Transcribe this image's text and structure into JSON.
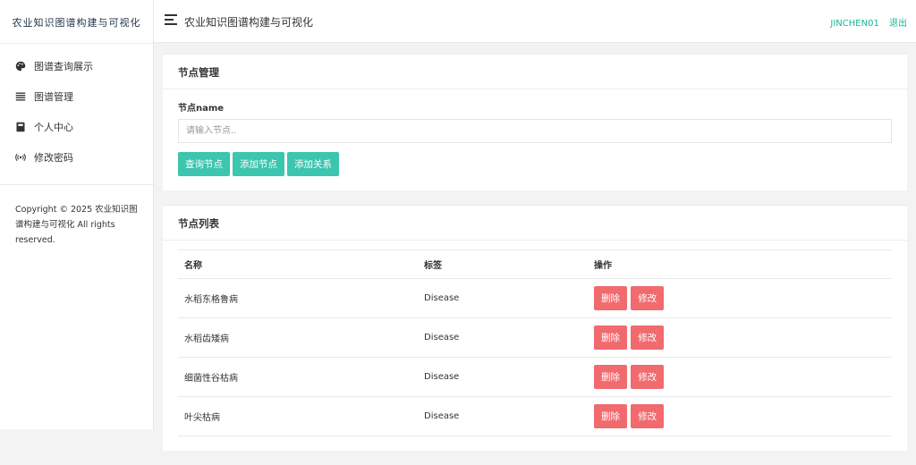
{
  "sidebar": {
    "brand": "农业知识图谱构建与可视化",
    "items": [
      {
        "label": "图谱查询展示",
        "icon": "palette-icon"
      },
      {
        "label": "图谱管理",
        "icon": "list-icon"
      },
      {
        "label": "个人中心",
        "icon": "book-icon"
      },
      {
        "label": "修改密码",
        "icon": "broadcast-icon"
      }
    ],
    "copyright": "Copyright © 2025 农业知识图谱构建与可视化 All rights reserved."
  },
  "topbar": {
    "title": "农业知识图谱构建与可视化",
    "user": "JINCHEN01",
    "logout": "退出"
  },
  "node_manage": {
    "title": "节点管理",
    "field_label": "节点name",
    "input_value": "",
    "input_placeholder": "请输入节点..",
    "buttons": {
      "query": "查询节点",
      "add_node": "添加节点",
      "add_relation": "添加关系"
    }
  },
  "node_list": {
    "title": "节点列表",
    "columns": {
      "name": "名称",
      "label": "标签",
      "action": "操作"
    },
    "delete_label": "删除",
    "edit_label": "修改",
    "rows": [
      {
        "name": "水稻东格鲁病",
        "label": "Disease"
      },
      {
        "name": "水稻齿矮病",
        "label": "Disease"
      },
      {
        "name": "细菌性谷枯病",
        "label": "Disease"
      },
      {
        "name": "叶尖枯病",
        "label": "Disease"
      }
    ]
  },
  "colors": {
    "accent": "#1ab394",
    "primary_button": "#3cc5af",
    "danger_button": "#f06a6e"
  }
}
